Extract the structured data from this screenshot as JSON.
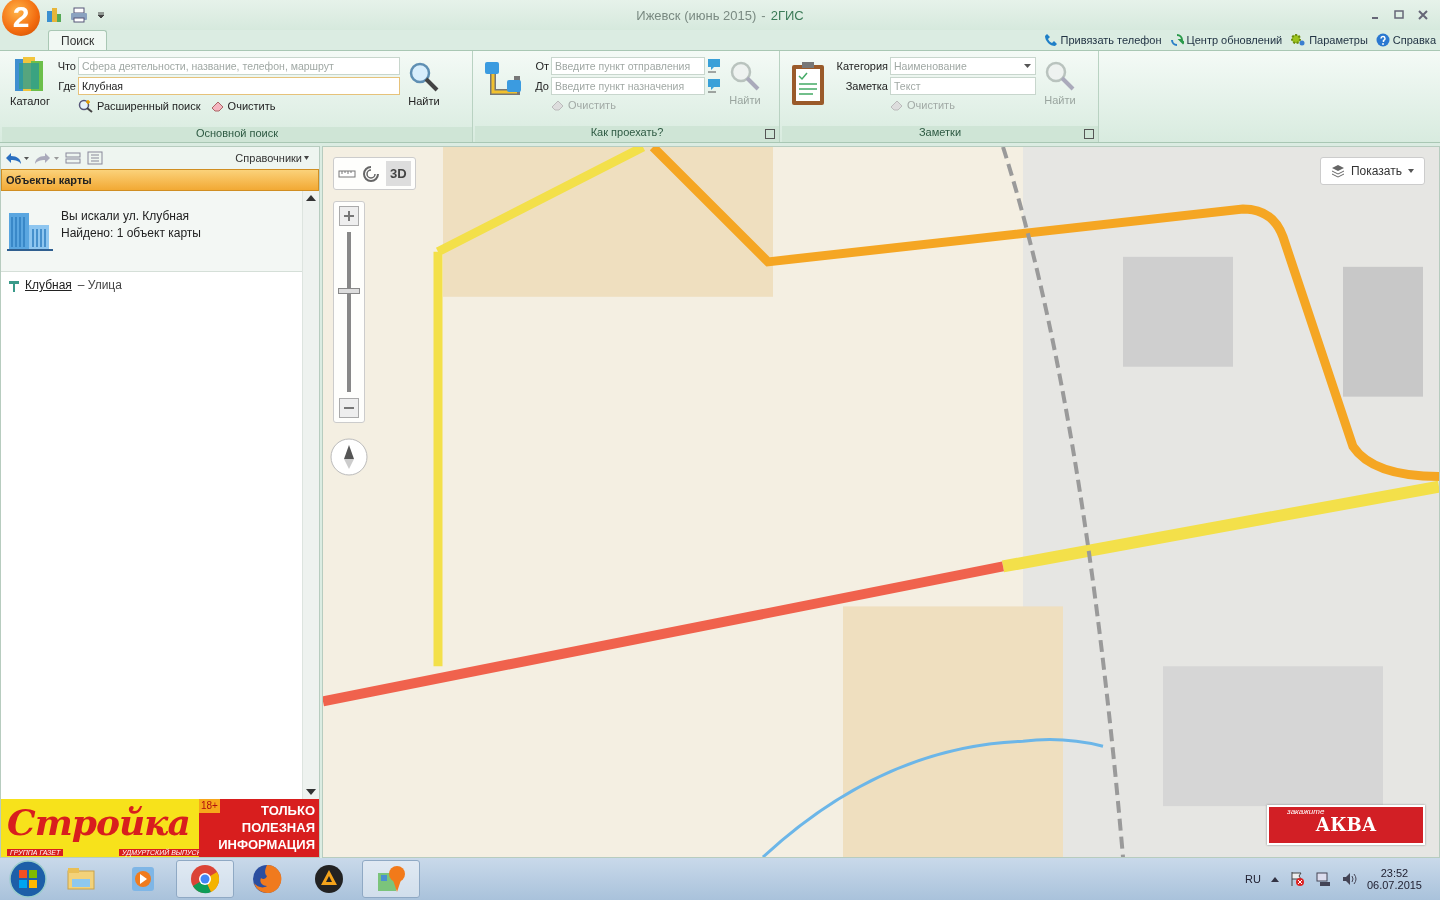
{
  "window": {
    "logo": "2",
    "title": "Ижевск (июнь 2015)",
    "separator": "-",
    "app": "2ГИС"
  },
  "ribbon_tabs": [
    {
      "label": "Поиск",
      "selected": true
    }
  ],
  "header_links": [
    {
      "kind": "phone",
      "label": "Привязать телефон"
    },
    {
      "kind": "refresh",
      "label": "Центр обновлений"
    },
    {
      "kind": "gear",
      "label": "Параметры"
    },
    {
      "kind": "help",
      "label": "Справка"
    }
  ],
  "main_search": {
    "catalog": "Каталог",
    "fields": [
      {
        "label": "Что",
        "placeholder": "Сфера деятельности, название, телефон, маршрут",
        "kind": "text"
      },
      {
        "label": "Где",
        "value": "Клубная",
        "kind": "text"
      }
    ],
    "find": "Найти",
    "advanced": "Расширенный поиск",
    "clear": "Очистить",
    "title": "Основной поиск",
    "disabled": false
  },
  "route": {
    "fields": [
      {
        "label": "От",
        "placeholder": "Введите пункт отправления",
        "kind": "text"
      },
      {
        "label": "До",
        "placeholder": "Введите пункт назначения",
        "kind": "text"
      }
    ],
    "clear": "Очистить",
    "find": "Найти",
    "title": "Как проехать?",
    "disabled": true
  },
  "notes": {
    "fields": [
      {
        "label": "Категория",
        "placeholder": "Наименование",
        "kind": "dropdown"
      },
      {
        "label": "Заметка",
        "placeholder": "Текст",
        "kind": "text"
      }
    ],
    "clear": "Очистить",
    "find": "Найти",
    "title": "Заметки",
    "disabled": true
  },
  "panel": {
    "directories": "Справочники",
    "header": "Объекты карты",
    "summary": [
      "Вы искали ул. Клубная",
      "Найдено: 1 объект карты"
    ],
    "results": [
      {
        "name": "Клубная",
        "type": "– Улица"
      }
    ]
  },
  "panel_ad": {
    "brand": "Стройка",
    "age": "18+",
    "slogan": "ТОЛЬКО ПОЛЕЗНАЯ ИНФОРМАЦИЯ",
    "group": "ГРУППА ГАЗЕТ",
    "edition": "УДМУРТСКИЙ ВЫПУСК"
  },
  "map": {
    "kind": "picture",
    "view_button": "3D",
    "zoom": {
      "level": 0.63
    },
    "show_button": "Показать",
    "ad": {
      "prefix": "закажите",
      "brand": "АКВА"
    }
  },
  "taskbar": {
    "apps": [
      {
        "kind": "folder",
        "selected": false
      },
      {
        "kind": "player",
        "selected": false
      },
      {
        "kind": "chrome",
        "selected": true
      },
      {
        "kind": "firefox",
        "selected": false
      },
      {
        "kind": "aimp",
        "selected": false
      },
      {
        "kind": "gis",
        "selected": true
      }
    ],
    "language": "RU",
    "time": "23:52",
    "date": "06.07.2015"
  }
}
